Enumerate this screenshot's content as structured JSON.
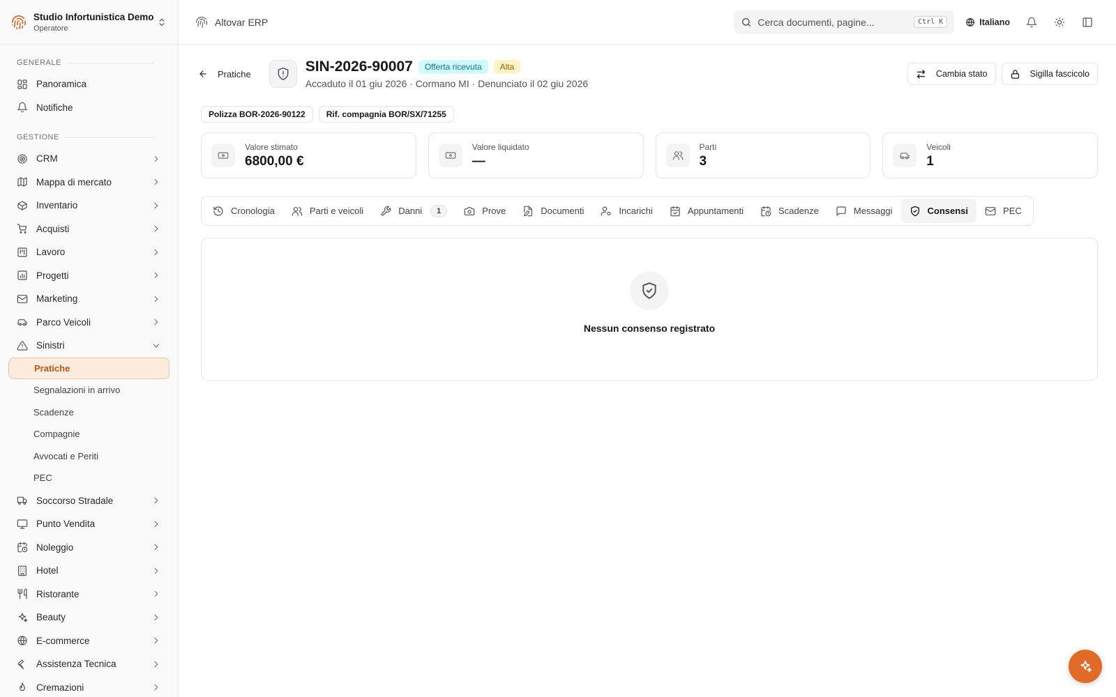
{
  "org": {
    "name": "Studio Infortunistica Demo",
    "role": "Operatore"
  },
  "sidebar": {
    "section_general": "GENERALE",
    "general_items": [
      {
        "label": "Panoramica",
        "icon": "dashboard-icon"
      },
      {
        "label": "Notifiche",
        "icon": "bell-icon"
      }
    ],
    "section_manage": "GESTIONE",
    "manage_items": [
      {
        "label": "CRM",
        "icon": "target-icon"
      },
      {
        "label": "Mappa di mercato",
        "icon": "map-icon"
      },
      {
        "label": "Inventario",
        "icon": "box-icon"
      },
      {
        "label": "Acquisti",
        "icon": "cart-icon"
      },
      {
        "label": "Lavoro",
        "icon": "kanban-icon"
      },
      {
        "label": "Progetti",
        "icon": "chart-icon"
      },
      {
        "label": "Marketing",
        "icon": "mail-icon"
      },
      {
        "label": "Parco Veicoli",
        "icon": "car-icon"
      },
      {
        "label": "Sinistri",
        "icon": "warning-icon"
      }
    ],
    "sinistri_sub": [
      "Pratiche",
      "Segnalazioni in arrivo",
      "Scadenze",
      "Compagnie",
      "Avvocati e Periti",
      "PEC"
    ],
    "more_items": [
      {
        "label": "Soccorso Stradale",
        "icon": "truck-icon"
      },
      {
        "label": "Punto Vendita",
        "icon": "monitor-icon"
      },
      {
        "label": "Noleggio",
        "icon": "calendar-clock-icon"
      },
      {
        "label": "Hotel",
        "icon": "building-icon"
      },
      {
        "label": "Ristorante",
        "icon": "utensils-icon"
      },
      {
        "label": "Beauty",
        "icon": "sparkles-icon"
      },
      {
        "label": "E-commerce",
        "icon": "globe-icon"
      },
      {
        "label": "Assistenza Tecnica",
        "icon": "wrench-icon"
      },
      {
        "label": "Cremazioni",
        "icon": "flame-icon"
      }
    ]
  },
  "topbar": {
    "brand": "Altovar ERP",
    "search_placeholder": "Cerca documenti, pagine...",
    "search_shortcut": "Ctrl K",
    "language": "Italiano"
  },
  "header": {
    "back_label": "Pratiche",
    "title": "SIN-2026-90007",
    "status_badge": "Offerta ricevuta",
    "priority_badge": "Alta",
    "subtitle": "Accaduto il 01 giu 2026 · Cormano MI · Denunciato il 02 giu 2026",
    "change_status": "Cambia stato",
    "seal": "Sigilla fascicolo"
  },
  "pills": {
    "policy": "Polizza BOR-2026-90122",
    "company_ref": "Rif. compagnia BOR/SX/71255"
  },
  "stats": [
    {
      "label": "Valore stimato",
      "value": "6800,00 €",
      "icon": "banknote-icon"
    },
    {
      "label": "Valore liquidato",
      "value": "—",
      "icon": "banknote-icon"
    },
    {
      "label": "Parti",
      "value": "3",
      "icon": "users-icon"
    },
    {
      "label": "Veicoli",
      "value": "1",
      "icon": "car-icon"
    }
  ],
  "tabs": {
    "cronologia": "Cronologia",
    "parti": "Parti e veicoli",
    "danni": "Danni",
    "danni_count": "1",
    "prove": "Prove",
    "documenti": "Documenti",
    "incarichi": "Incarichi",
    "appuntamenti": "Appuntamenti",
    "scadenze": "Scadenze",
    "messaggi": "Messaggi",
    "consensi": "Consensi",
    "pec": "PEC",
    "active": "Consensi"
  },
  "empty": {
    "text": "Nessun consenso registrato"
  },
  "colors": {
    "accent": "#e06b28",
    "active_bg": "#fdecde",
    "active_text": "#c2570f",
    "status_cyan": "#cffafe",
    "priority_yellow": "#fef3c7"
  }
}
